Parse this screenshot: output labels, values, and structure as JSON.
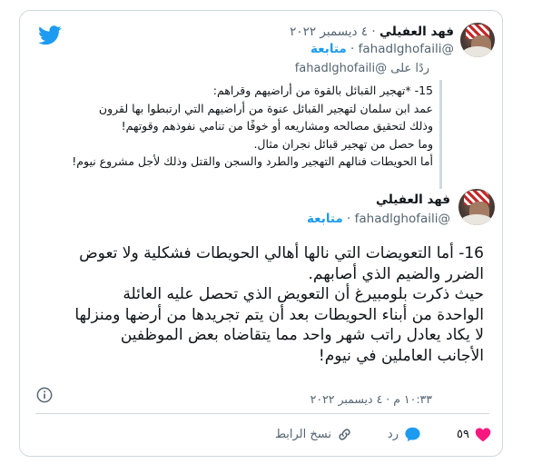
{
  "app": {
    "logo": "twitter-bird-icon",
    "accent": "#1d9bf0",
    "like_color": "#f91880"
  },
  "reply_tweet": {
    "name": "فهد العفيلي",
    "date": "٤ ديسمبر ٢٠٢٢",
    "follow": "متابعة",
    "handle": "@fahadlghofaili",
    "reply_to": "ردًا على @fahadlghofaili",
    "lines": [
      "15- *تهجير القبائل بالقوة من أراضيهم وقراهم:",
      "عمد ابن سلمان لتهجير القبائل عنوة من أراضيهم التي ارتبطوا بها لقرون",
      "وذلك لتحقيق مصالحه ومشاريعه أو خوفًا من تنامي نفوذهم وقوتهم!",
      "وما حصل من تهجير قبائل نجران مثال.",
      "أما الحويطات فنالهم التهجير والطرد والسجن والقتل وذلك لأجل مشروع نيوم!"
    ]
  },
  "main_tweet": {
    "name": "فهد العفيلي",
    "follow": "متابعة",
    "handle": "@fahadlghofaili",
    "lines": [
      "16- أما التعويضات التي نالها أهالي الحويطات فشكلية ولا تعوض",
      "الضرر والضيم الذي أصابهم.",
      "حيث ذكرت بلومبيرغ أن التعويض الذي تحصل عليه العائلة",
      "الواحدة من أبناء الحويطات بعد أن يتم تجريدها من أرضها ومنزلها",
      "لا يكاد يعادل راتب شهر واحد مما يتقاضاه بعض الموظفين",
      "الأجانب العاملين في نيوم!"
    ],
    "timestamp": "١٠:٣٣ م · ٤ ديسمبر ٢٠٢٢",
    "likes": "٥٩",
    "reply_label": "رد",
    "copy_link_label": "نسخ الرابط"
  }
}
